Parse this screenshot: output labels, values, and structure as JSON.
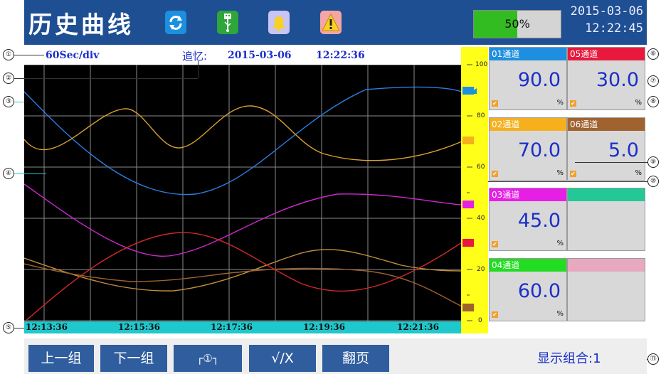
{
  "header": {
    "title": "历史曲线",
    "icons": [
      "refresh-icon",
      "usb-icon",
      "bell-icon",
      "warning-icon"
    ],
    "battery_percent": 50,
    "battery_label": "50%",
    "date": "2015-03-06",
    "time": "12:22:45"
  },
  "info_bar": {
    "time_scale": "60Sec/div",
    "recall_label": "追忆:",
    "recall_date": "2015-03-06",
    "recall_time": "12:22:36"
  },
  "time_axis": {
    "labels": [
      "12:13:36",
      "12:15:36",
      "12:17:36",
      "12:19:36",
      "12:21:36"
    ]
  },
  "scale": {
    "ticks": [
      "100",
      "80",
      "60",
      "40",
      "20",
      "0"
    ],
    "min": 0,
    "max": 100
  },
  "channels": [
    {
      "name": "01通道",
      "value": "90.0",
      "unit": "%",
      "color": "#1e8fe0"
    },
    {
      "name": "05通道",
      "value": "30.0",
      "unit": "%",
      "color": "#e8193c"
    },
    {
      "name": "02通道",
      "value": "70.0",
      "unit": "%",
      "color": "#f5b01c"
    },
    {
      "name": "06通道",
      "value": "5.0",
      "unit": "%",
      "color": "#a0622f"
    },
    {
      "name": "03通道",
      "value": "45.0",
      "unit": "%",
      "color": "#e61ee6"
    },
    {
      "name": "",
      "value": "",
      "unit": "",
      "color": "#24c896"
    },
    {
      "name": "04通道",
      "value": "60.0",
      "unit": "%",
      "color": "#22dd22"
    },
    {
      "name": "",
      "value": "",
      "unit": "",
      "color": "#e8a8c0"
    }
  ],
  "buttons": {
    "prev_group": "上一组",
    "next_group": "下一组",
    "cursor": "┌①┐",
    "check": "√/X",
    "page": "翻页"
  },
  "display_combo": "显示组合:1",
  "callouts": [
    "①",
    "②",
    "③",
    "④",
    "⑤",
    "⑥",
    "⑦",
    "⑧",
    "⑨",
    "⑩",
    "⑪"
  ]
}
